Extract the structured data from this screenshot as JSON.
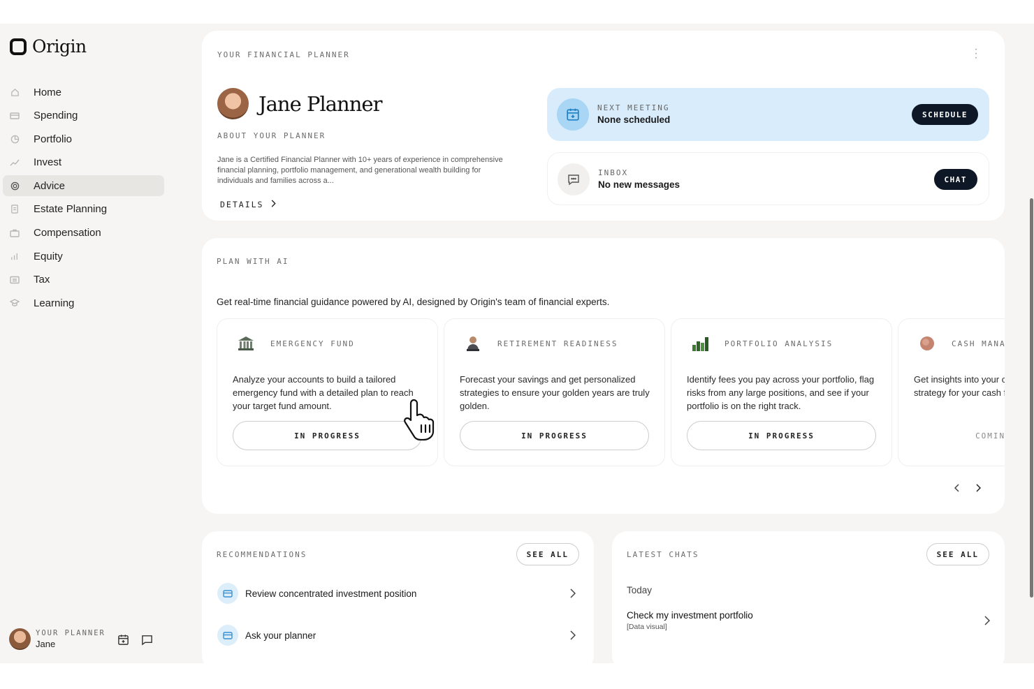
{
  "brand": {
    "name": "Origin"
  },
  "sidebar": {
    "items": [
      {
        "label": "Home",
        "icon": "home-icon"
      },
      {
        "label": "Spending",
        "icon": "card-icon"
      },
      {
        "label": "Portfolio",
        "icon": "pie-icon"
      },
      {
        "label": "Invest",
        "icon": "trend-icon"
      },
      {
        "label": "Advice",
        "icon": "target-icon",
        "active": true
      },
      {
        "label": "Estate Planning",
        "icon": "document-icon"
      },
      {
        "label": "Compensation",
        "icon": "briefcase-icon"
      },
      {
        "label": "Equity",
        "icon": "bar-chart-icon"
      },
      {
        "label": "Tax",
        "icon": "receipt-icon"
      },
      {
        "label": "Learning",
        "icon": "graduation-icon"
      }
    ],
    "footer": {
      "caption": "YOUR PLANNER",
      "name": "Jane"
    }
  },
  "planner": {
    "section_title": "YOUR FINANCIAL PLANNER",
    "name": "Jane Planner",
    "about_title": "ABOUT YOUR PLANNER",
    "about_text": "Jane is a Certified Financial Planner with 10+ years of experience in comprehensive financial planning, portfolio management, and generational wealth building for individuals and families across a...",
    "details_label": "DETAILS",
    "next_meeting": {
      "caption": "NEXT MEETING",
      "value": "None scheduled",
      "button": "SCHEDULE"
    },
    "inbox": {
      "caption": "INBOX",
      "value": "No new messages",
      "button": "CHAT"
    }
  },
  "ai": {
    "section_title": "PLAN WITH AI",
    "description": "Get real-time financial guidance powered by AI, designed by Origin's team of financial experts.",
    "tiles": [
      {
        "title": "EMERGENCY FUND",
        "icon": "bank-icon",
        "description": "Analyze your accounts to build a tailored emergency fund with a detailed plan to reach your target fund amount.",
        "status": "IN PROGRESS"
      },
      {
        "title": "RETIREMENT READINESS",
        "icon": "retiree-icon",
        "description": "Forecast your savings and get personalized strategies to ensure your golden years are truly golden.",
        "status": "IN PROGRESS"
      },
      {
        "title": "PORTFOLIO ANALYSIS",
        "icon": "growth-chart-icon",
        "description": "Identify fees you pay across your portfolio, flag risks from any large positions, and see if your portfolio is on the right track.",
        "status": "IN PROGRESS"
      },
      {
        "title": "CASH MANAGEMENT",
        "icon": "coin-icon",
        "description": "Get insights into your cash and create a strategy for your cash flow.",
        "status": "COMING SOON"
      }
    ]
  },
  "recommendations": {
    "section_title": "RECOMMENDATIONS",
    "see_all": "SEE ALL",
    "items": [
      {
        "label": "Review concentrated investment position"
      },
      {
        "label": "Ask your planner"
      }
    ]
  },
  "chats": {
    "section_title": "LATEST CHATS",
    "see_all": "SEE ALL",
    "group": "Today",
    "items": [
      {
        "title": "Check my investment portfolio",
        "subtitle": "[Data visual]"
      }
    ]
  }
}
